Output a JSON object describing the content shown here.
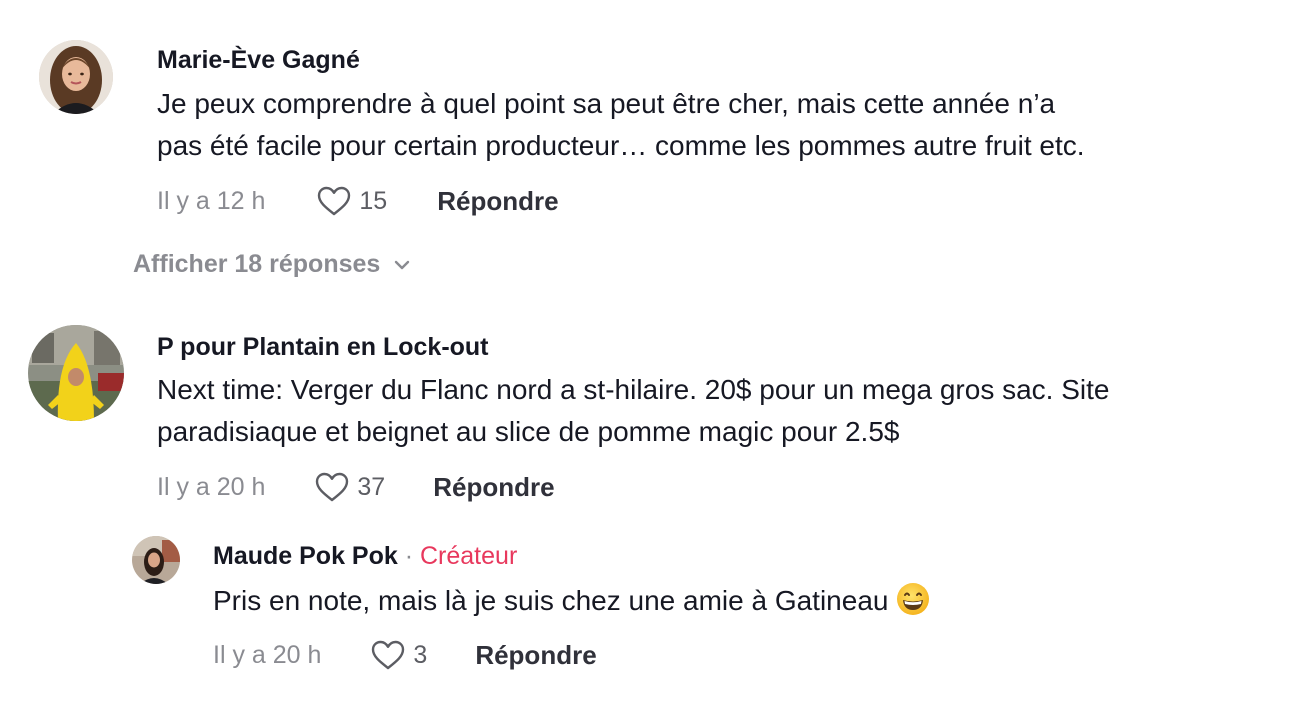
{
  "comments": [
    {
      "author": "Marie-Ève Gagné",
      "text_line1": "Je peux comprendre à quel point sa peut être cher, mais cette année n’a",
      "text_line2": "pas été facile pour certain producteur… comme les pommes autre fruit etc.",
      "time": "Il y a 12 h",
      "likes": "15",
      "reply_label": "Répondre",
      "show_replies_label": "Afficher 18 réponses",
      "avatar_icon": "avatar-woman-brown-hair"
    },
    {
      "author": "P pour Plantain en Lock-out",
      "text_line1": "Next time: Verger du Flanc nord a st-hilaire. 20$ pour un mega gros sac. Site",
      "text_line2": "paradisiaque et beignet au slice de pomme magic pour 2.5$",
      "time": "Il y a 20 h",
      "likes": "37",
      "reply_label": "Répondre",
      "avatar_icon": "avatar-banana-costume"
    }
  ],
  "reply": {
    "author": "Maude Pok Pok",
    "separator": "·",
    "creator_label": "Créateur",
    "text": "Pris en note, mais là je suis chez une amie à Gatineau",
    "emoji_icon": "grinning-face-emoji",
    "time": "Il y a 20 h",
    "likes": "3",
    "reply_label": "Répondre",
    "avatar_icon": "avatar-woman-street"
  },
  "colors": {
    "text": "#161823",
    "secondary": "#8a8b91",
    "creator": "#e8385d"
  }
}
